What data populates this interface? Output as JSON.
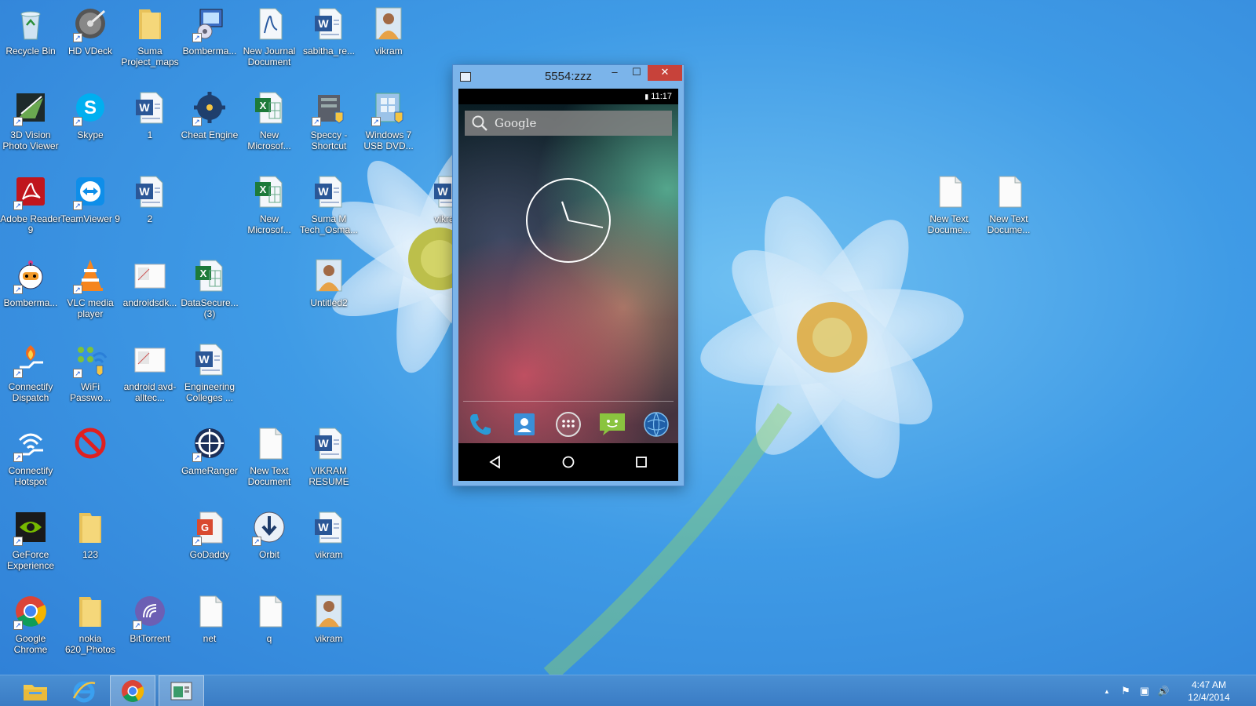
{
  "desktop": {
    "icons": [
      {
        "label": "Recycle Bin",
        "icon": "recycle-bin-icon"
      },
      {
        "label": "HD VDeck",
        "icon": "media-app-icon"
      },
      {
        "label": "Suma Project_maps",
        "icon": "folder-icon"
      },
      {
        "label": "Bomberma...",
        "icon": "app-installer-icon"
      },
      {
        "label": "New Journal Document",
        "icon": "journal-document-icon"
      },
      {
        "label": "sabitha_re...",
        "icon": "word-document-icon"
      },
      {
        "label": "vikram",
        "icon": "photo-icon"
      },
      {
        "label": "3D Vision Photo Viewer",
        "icon": "3d-vision-icon"
      },
      {
        "label": "Skype",
        "icon": "skype-icon"
      },
      {
        "label": "1",
        "icon": "word-document-icon"
      },
      {
        "label": "Cheat Engine",
        "icon": "cheat-engine-icon"
      },
      {
        "label": "New Microsof...",
        "icon": "excel-document-icon"
      },
      {
        "label": "Speccy - Shortcut",
        "icon": "speccy-icon"
      },
      {
        "label": "Windows 7 USB DVD...",
        "icon": "windows-usb-dvd-icon"
      },
      {
        "label": "Adobe Reader 9",
        "icon": "adobe-reader-icon"
      },
      {
        "label": "TeamViewer 9",
        "icon": "teamviewer-icon"
      },
      {
        "label": "2",
        "icon": "word-document-icon"
      },
      {
        "label": "New Microsof...",
        "icon": "excel-document-icon"
      },
      {
        "label": "Suma M Tech_Osma...",
        "icon": "word-document-icon"
      },
      {
        "label": "vikram",
        "icon": "word-document-icon"
      },
      {
        "label": "Bomberma...",
        "icon": "bomberman-icon"
      },
      {
        "label": "VLC media player",
        "icon": "vlc-icon"
      },
      {
        "label": "androidsdk...",
        "icon": "image-file-icon"
      },
      {
        "label": "DataSecure... (3)",
        "icon": "excel-document-icon"
      },
      {
        "label": "Untitled2",
        "icon": "photo-icon"
      },
      {
        "label": "Connectify Dispatch",
        "icon": "connectify-dispatch-icon"
      },
      {
        "label": "WiFi Passwo...",
        "icon": "wifi-password-icon"
      },
      {
        "label": "android avd-alltec...",
        "icon": "image-file-icon"
      },
      {
        "label": "Engineering Colleges ...",
        "icon": "word-document-icon"
      },
      {
        "label": "Connectify Hotspot",
        "icon": "connectify-hotspot-icon"
      },
      {
        "label": "",
        "icon": "prohibited-icon"
      },
      {
        "label": "GameRanger",
        "icon": "gameranger-icon"
      },
      {
        "label": "New Text Document",
        "icon": "text-document-icon"
      },
      {
        "label": "VIKRAM RESUME",
        "icon": "word-document-icon"
      },
      {
        "label": "GeForce Experience",
        "icon": "geforce-icon"
      },
      {
        "label": "123",
        "icon": "folder-icon"
      },
      {
        "label": "GoDaddy",
        "icon": "godaddy-icon"
      },
      {
        "label": "Orbit",
        "icon": "orbit-downloader-icon"
      },
      {
        "label": "vikram",
        "icon": "word-document-icon"
      },
      {
        "label": "Google Chrome",
        "icon": "chrome-icon"
      },
      {
        "label": "nokia 620_Photos",
        "icon": "folder-icon"
      },
      {
        "label": "BitTorrent",
        "icon": "bittorrent-icon"
      },
      {
        "label": "net",
        "icon": "text-document-icon"
      },
      {
        "label": "q",
        "icon": "text-document-icon"
      },
      {
        "label": "vikram",
        "icon": "photo-icon"
      },
      {
        "label": "New Text Docume...",
        "icon": "text-document-icon"
      },
      {
        "label": "New Text Docume...",
        "icon": "text-document-icon"
      }
    ]
  },
  "emulator": {
    "title": "5554:zzz",
    "minimize_label": "‒",
    "maximize_label": "☐",
    "close_label": "✕",
    "status_time": "11:17",
    "search_placeholder": "Google",
    "dock_apps": [
      "phone-icon",
      "contacts-icon",
      "app-drawer-icon",
      "messaging-icon",
      "browser-icon"
    ],
    "nav": [
      "back-icon",
      "home-icon",
      "recents-icon"
    ]
  },
  "taskbar": {
    "pinned": [
      "file-explorer-icon",
      "internet-explorer-icon",
      "chrome-icon",
      "emulator-window-icon"
    ],
    "tray_icons": [
      "show-hidden-icons-icon",
      "action-center-flag-icon",
      "network-icon",
      "volume-icon"
    ],
    "tray_glyphs": [
      "▲",
      "⚑",
      "▣",
      "🔊"
    ],
    "time": "4:47 AM",
    "date": "12/4/2014"
  }
}
